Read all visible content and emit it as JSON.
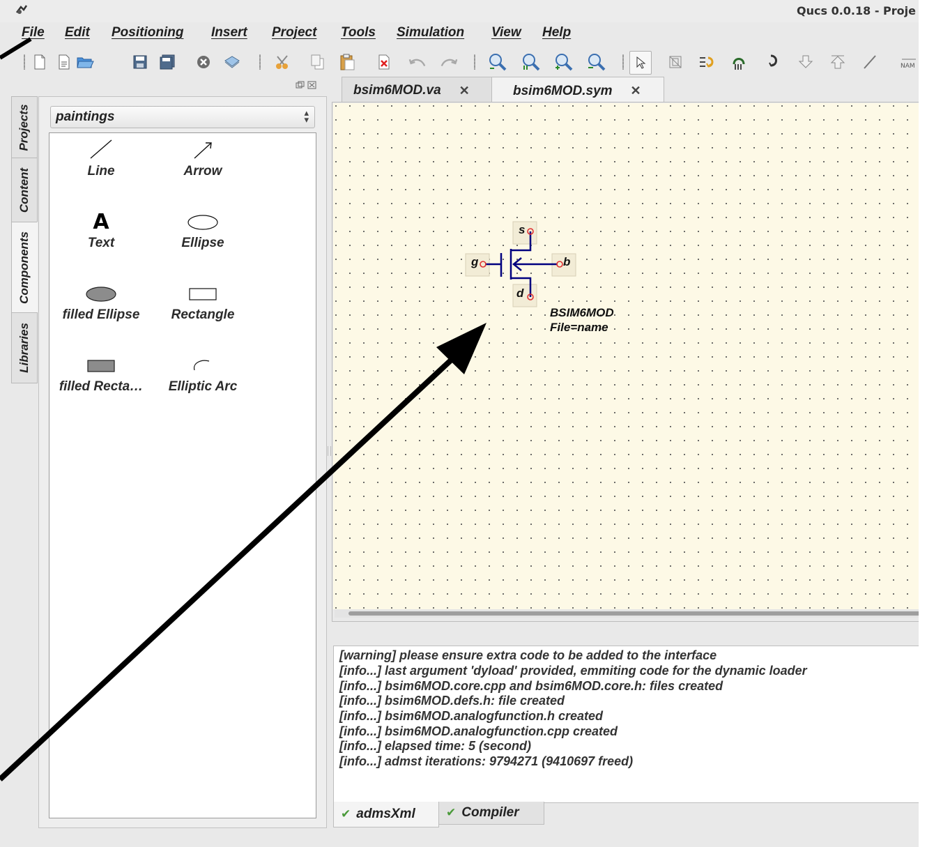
{
  "window": {
    "title": "Qucs 0.0.18 - Proje"
  },
  "menu": {
    "items": [
      {
        "label": "File"
      },
      {
        "label": "Edit"
      },
      {
        "label": "Positioning"
      },
      {
        "label": "Insert"
      },
      {
        "label": "Project"
      },
      {
        "label": "Tools"
      },
      {
        "label": "Simulation"
      },
      {
        "label": "View"
      },
      {
        "label": "Help"
      }
    ]
  },
  "toolbar": {
    "icons": [
      "new-file-icon",
      "new-text-icon",
      "open-folder-icon",
      "save-icon",
      "save-all-icon",
      "close-icon",
      "print-icon",
      "cut-icon",
      "copy-icon",
      "paste-icon",
      "delete-icon",
      "undo-icon",
      "redo-icon",
      "zoom-fit-icon",
      "zoom-1to1-icon",
      "zoom-in-icon",
      "zoom-out-icon",
      "select-icon",
      "deactivate-icon",
      "rotate-icon",
      "mirror-x-icon",
      "mirror-y-icon",
      "go-into-icon",
      "pop-out-icon",
      "wire-icon",
      "label-icon"
    ],
    "label_icon_text": "NAM"
  },
  "sidebar": {
    "tabs": [
      {
        "label": "Projects"
      },
      {
        "label": "Content"
      },
      {
        "label": "Components"
      },
      {
        "label": "Libraries"
      }
    ],
    "active_tab": "Components",
    "category": "paintings",
    "components": [
      {
        "label": "Line",
        "icon": "line-icon"
      },
      {
        "label": "Arrow",
        "icon": "arrow-icon"
      },
      {
        "label": "Text",
        "icon": "text-icon",
        "glyph": "A"
      },
      {
        "label": "Ellipse",
        "icon": "ellipse-icon"
      },
      {
        "label": "filled Ellipse",
        "icon": "filled-ellipse-icon"
      },
      {
        "label": "Rectangle",
        "icon": "rectangle-icon"
      },
      {
        "label": "filled Recta…",
        "icon": "filled-rectangle-icon"
      },
      {
        "label": "Elliptic Arc",
        "icon": "elliptic-arc-icon"
      }
    ]
  },
  "editor": {
    "tabs": [
      {
        "label": "bsim6MOD.va",
        "close": "✕"
      },
      {
        "label": "bsim6MOD.sym",
        "close": "✕"
      }
    ],
    "active_tab": "bsim6MOD.sym",
    "symbol": {
      "ports": {
        "source": "s",
        "gate": "g",
        "bulk": "b",
        "drain": "d"
      },
      "name": "BSIM6MOD",
      "property": "File=name",
      "color": "#00007f",
      "port_color": "#e03030"
    }
  },
  "messages": {
    "lines": [
      "[warning] please ensure extra code to be added to the interface",
      "[info...] last argument 'dyload' provided, emmiting code for the dynamic loader",
      "[info...] bsim6MOD.core.cpp and bsim6MOD.core.h: files created",
      "[info...] bsim6MOD.defs.h: file created",
      "[info...] bsim6MOD.analogfunction.h created",
      "[info...] bsim6MOD.analogfunction.cpp created",
      "[info...] elapsed time: 5 (second)",
      "[info...] admst iterations: 9794271 (9410697 freed)"
    ],
    "tabs": [
      {
        "label": "admsXml",
        "icon": "check-icon"
      },
      {
        "label": "Compiler",
        "icon": "check-icon"
      }
    ],
    "active_tab": "admsXml"
  },
  "colors": {
    "canvas_bg": "#fdf9e6",
    "annotation": "#000000"
  }
}
